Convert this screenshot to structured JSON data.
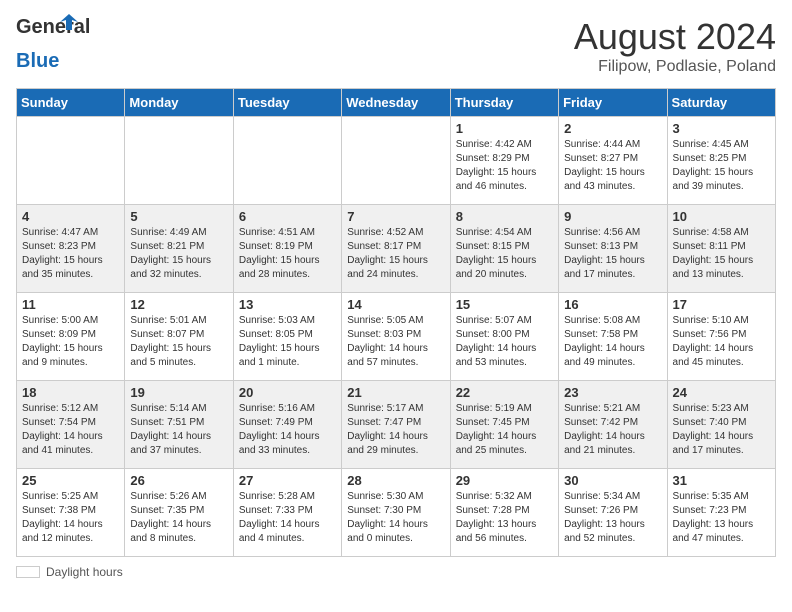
{
  "header": {
    "logo_general": "General",
    "logo_blue": "Blue",
    "month_year": "August 2024",
    "location": "Filipow, Podlasie, Poland"
  },
  "calendar": {
    "days_of_week": [
      "Sunday",
      "Monday",
      "Tuesday",
      "Wednesday",
      "Thursday",
      "Friday",
      "Saturday"
    ],
    "weeks": [
      [
        {
          "day": "",
          "content": ""
        },
        {
          "day": "",
          "content": ""
        },
        {
          "day": "",
          "content": ""
        },
        {
          "day": "",
          "content": ""
        },
        {
          "day": "1",
          "content": "Sunrise: 4:42 AM\nSunset: 8:29 PM\nDaylight: 15 hours and 46 minutes."
        },
        {
          "day": "2",
          "content": "Sunrise: 4:44 AM\nSunset: 8:27 PM\nDaylight: 15 hours and 43 minutes."
        },
        {
          "day": "3",
          "content": "Sunrise: 4:45 AM\nSunset: 8:25 PM\nDaylight: 15 hours and 39 minutes."
        }
      ],
      [
        {
          "day": "4",
          "content": "Sunrise: 4:47 AM\nSunset: 8:23 PM\nDaylight: 15 hours and 35 minutes."
        },
        {
          "day": "5",
          "content": "Sunrise: 4:49 AM\nSunset: 8:21 PM\nDaylight: 15 hours and 32 minutes."
        },
        {
          "day": "6",
          "content": "Sunrise: 4:51 AM\nSunset: 8:19 PM\nDaylight: 15 hours and 28 minutes."
        },
        {
          "day": "7",
          "content": "Sunrise: 4:52 AM\nSunset: 8:17 PM\nDaylight: 15 hours and 24 minutes."
        },
        {
          "day": "8",
          "content": "Sunrise: 4:54 AM\nSunset: 8:15 PM\nDaylight: 15 hours and 20 minutes."
        },
        {
          "day": "9",
          "content": "Sunrise: 4:56 AM\nSunset: 8:13 PM\nDaylight: 15 hours and 17 minutes."
        },
        {
          "day": "10",
          "content": "Sunrise: 4:58 AM\nSunset: 8:11 PM\nDaylight: 15 hours and 13 minutes."
        }
      ],
      [
        {
          "day": "11",
          "content": "Sunrise: 5:00 AM\nSunset: 8:09 PM\nDaylight: 15 hours and 9 minutes."
        },
        {
          "day": "12",
          "content": "Sunrise: 5:01 AM\nSunset: 8:07 PM\nDaylight: 15 hours and 5 minutes."
        },
        {
          "day": "13",
          "content": "Sunrise: 5:03 AM\nSunset: 8:05 PM\nDaylight: 15 hours and 1 minute."
        },
        {
          "day": "14",
          "content": "Sunrise: 5:05 AM\nSunset: 8:03 PM\nDaylight: 14 hours and 57 minutes."
        },
        {
          "day": "15",
          "content": "Sunrise: 5:07 AM\nSunset: 8:00 PM\nDaylight: 14 hours and 53 minutes."
        },
        {
          "day": "16",
          "content": "Sunrise: 5:08 AM\nSunset: 7:58 PM\nDaylight: 14 hours and 49 minutes."
        },
        {
          "day": "17",
          "content": "Sunrise: 5:10 AM\nSunset: 7:56 PM\nDaylight: 14 hours and 45 minutes."
        }
      ],
      [
        {
          "day": "18",
          "content": "Sunrise: 5:12 AM\nSunset: 7:54 PM\nDaylight: 14 hours and 41 minutes."
        },
        {
          "day": "19",
          "content": "Sunrise: 5:14 AM\nSunset: 7:51 PM\nDaylight: 14 hours and 37 minutes."
        },
        {
          "day": "20",
          "content": "Sunrise: 5:16 AM\nSunset: 7:49 PM\nDaylight: 14 hours and 33 minutes."
        },
        {
          "day": "21",
          "content": "Sunrise: 5:17 AM\nSunset: 7:47 PM\nDaylight: 14 hours and 29 minutes."
        },
        {
          "day": "22",
          "content": "Sunrise: 5:19 AM\nSunset: 7:45 PM\nDaylight: 14 hours and 25 minutes."
        },
        {
          "day": "23",
          "content": "Sunrise: 5:21 AM\nSunset: 7:42 PM\nDaylight: 14 hours and 21 minutes."
        },
        {
          "day": "24",
          "content": "Sunrise: 5:23 AM\nSunset: 7:40 PM\nDaylight: 14 hours and 17 minutes."
        }
      ],
      [
        {
          "day": "25",
          "content": "Sunrise: 5:25 AM\nSunset: 7:38 PM\nDaylight: 14 hours and 12 minutes."
        },
        {
          "day": "26",
          "content": "Sunrise: 5:26 AM\nSunset: 7:35 PM\nDaylight: 14 hours and 8 minutes."
        },
        {
          "day": "27",
          "content": "Sunrise: 5:28 AM\nSunset: 7:33 PM\nDaylight: 14 hours and 4 minutes."
        },
        {
          "day": "28",
          "content": "Sunrise: 5:30 AM\nSunset: 7:30 PM\nDaylight: 14 hours and 0 minutes."
        },
        {
          "day": "29",
          "content": "Sunrise: 5:32 AM\nSunset: 7:28 PM\nDaylight: 13 hours and 56 minutes."
        },
        {
          "day": "30",
          "content": "Sunrise: 5:34 AM\nSunset: 7:26 PM\nDaylight: 13 hours and 52 minutes."
        },
        {
          "day": "31",
          "content": "Sunrise: 5:35 AM\nSunset: 7:23 PM\nDaylight: 13 hours and 47 minutes."
        }
      ]
    ]
  },
  "legend": {
    "daylight_hours": "Daylight hours"
  }
}
